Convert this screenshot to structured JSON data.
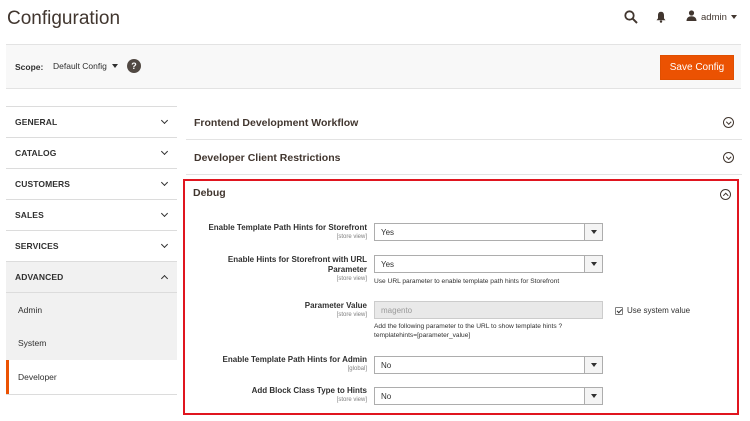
{
  "header": {
    "title": "Configuration",
    "user_name": "admin",
    "icons": [
      "search-icon",
      "bell-icon",
      "user-icon"
    ]
  },
  "scope_bar": {
    "scope_label": "Scope:",
    "scope_value": "Default Config",
    "help": "?",
    "save_label": "Save Config"
  },
  "colors": {
    "accent": "#eb5202",
    "highlight_border": "#e0151f"
  },
  "sidebar": {
    "tabs": [
      {
        "label": "GENERAL",
        "expanded": false
      },
      {
        "label": "CATALOG",
        "expanded": false
      },
      {
        "label": "CUSTOMERS",
        "expanded": false
      },
      {
        "label": "SALES",
        "expanded": false
      },
      {
        "label": "SERVICES",
        "expanded": false
      },
      {
        "label": "ADVANCED",
        "expanded": true
      }
    ],
    "advanced_items": [
      "Admin",
      "System",
      "Developer"
    ],
    "current_item": "Developer"
  },
  "sections": {
    "frontend_workflow": "Frontend Development Workflow",
    "client_restrictions": "Developer Client Restrictions",
    "debug": {
      "title": "Debug",
      "rows": [
        {
          "label": "Enable Template Path Hints for Storefront",
          "scope": "[store view]",
          "value": "Yes"
        },
        {
          "label": "Enable Hints for Storefront with URL Parameter",
          "scope": "[store view]",
          "value": "Yes",
          "note": "Use URL parameter to enable template path hints for Storefront"
        },
        {
          "label": "Parameter Value",
          "scope": "[store view]",
          "value": "magento",
          "note": "Add the following parameter to the URL to show template hints ? templatehints=[parameter_value]",
          "system_value_label": "Use system value",
          "system_value_checked": true
        },
        {
          "label": "Enable Template Path Hints for Admin",
          "scope": "[global]",
          "value": "No"
        },
        {
          "label": "Add Block Class Type to Hints",
          "scope": "[store view]",
          "value": "No"
        }
      ]
    }
  }
}
